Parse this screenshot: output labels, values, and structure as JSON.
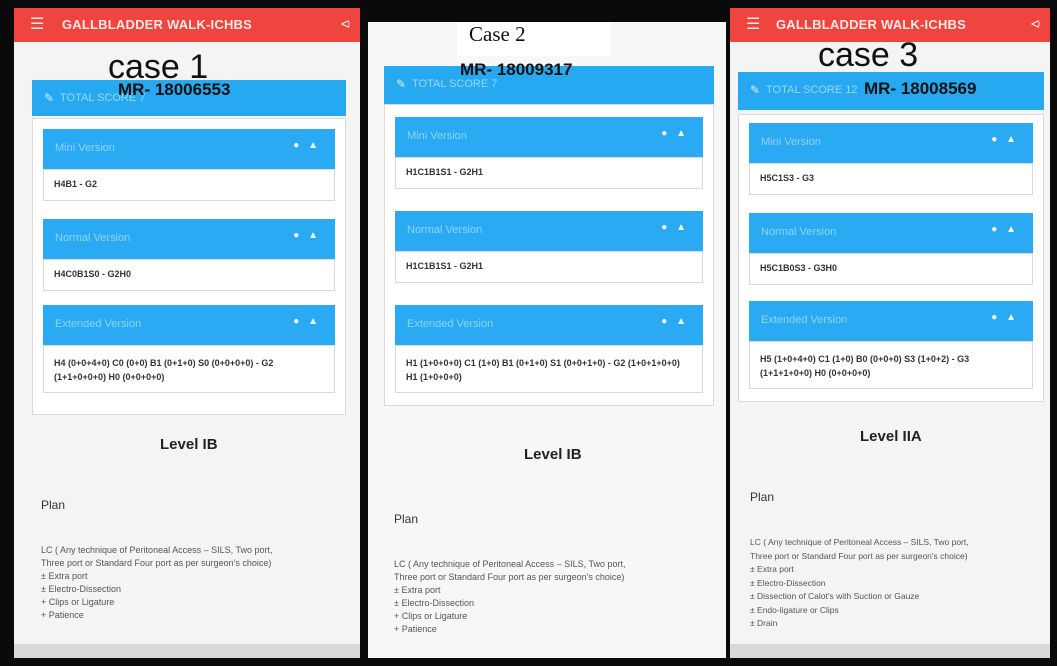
{
  "screens": [
    {
      "case_title": "case 1",
      "app_title": "GALLBLADDER WALK-ICHBS",
      "mr": "MR- 18006553",
      "total_score_label": "TOTAL SCORE 7",
      "mini_label": "Mini Version",
      "mini_value": "H4B1 - G2",
      "normal_label": "Normal Version",
      "normal_value": "H4C0B1S0 - G2H0",
      "extended_label": "Extended Version",
      "extended_value": "H4 (0+0+4+0) C0 (0+0) B1 (0+1+0) S0 (0+0+0+0) - G2 (1+1+0+0+0) H0 (0+0+0+0)",
      "level": "Level IB",
      "plan_heading": "Plan",
      "plan_lines": [
        "LC ( Any technique of Peritoneal Access – SILS, Two port,",
        "Three port or Standard Four port as per surgeon's choice)",
        "± Extra port",
        "± Electro-Dissection",
        "+ Clips or Ligature",
        "+ Patience"
      ]
    },
    {
      "case_title": "Case 2",
      "mr": "MR- 18009317",
      "total_score_label": "TOTAL SCORE 7",
      "mini_label": "Mini Version",
      "mini_value": "H1C1B1S1 - G2H1",
      "normal_label": "Normal Version",
      "normal_value": "H1C1B1S1 - G2H1",
      "extended_label": "Extended Version",
      "extended_value": "H1 (1+0+0+0) C1 (1+0) B1 (0+1+0) S1 (0+0+1+0) - G2 (1+0+1+0+0) H1 (1+0+0+0)",
      "level": "Level IB",
      "plan_heading": "Plan",
      "plan_lines": [
        "LC ( Any technique of Peritoneal Access – SILS, Two port,",
        "Three port or Standard Four port as per surgeon's choice)",
        "± Extra port",
        "± Electro-Dissection",
        "+ Clips or Ligature",
        "+ Patience"
      ]
    },
    {
      "case_title": "case 3",
      "app_title": "GALLBLADDER WALK-ICHBS",
      "mr": "MR- 18008569",
      "total_score_label": "TOTAL SCORE 12",
      "mini_label": "Mini Version",
      "mini_value": "H5C1S3 - G3",
      "normal_label": "Normal Version",
      "normal_value": "H5C1B0S3 - G3H0",
      "extended_label": "Extended Version",
      "extended_value": "H5 (1+0+4+0) C1 (1+0) B0 (0+0+0) S3 (1+0+2) - G3 (1+1+1+0+0) H0 (0+0+0+0)",
      "level": "Level IIA",
      "plan_heading": "Plan",
      "plan_lines": [
        "LC ( Any technique of Peritoneal Access – SILS, Two port,",
        "Three port or Standard Four port as per surgeon's choice)",
        "± Extra port",
        "± Electro-Dissection",
        "± Dissection of Calot's with Suction or Gauze",
        "± Endo-ligature or Clips",
        "± Drain"
      ]
    }
  ],
  "colors": {
    "appbar": "#f0443f",
    "accent_blue": "#27a9f1",
    "frame": "#0a0a0a"
  },
  "icons": {
    "menu": "hamburger-menu-icon",
    "share": "share-icon",
    "edit": "edit-icon",
    "expand_collapse": "dot-chevron-up-icon"
  }
}
